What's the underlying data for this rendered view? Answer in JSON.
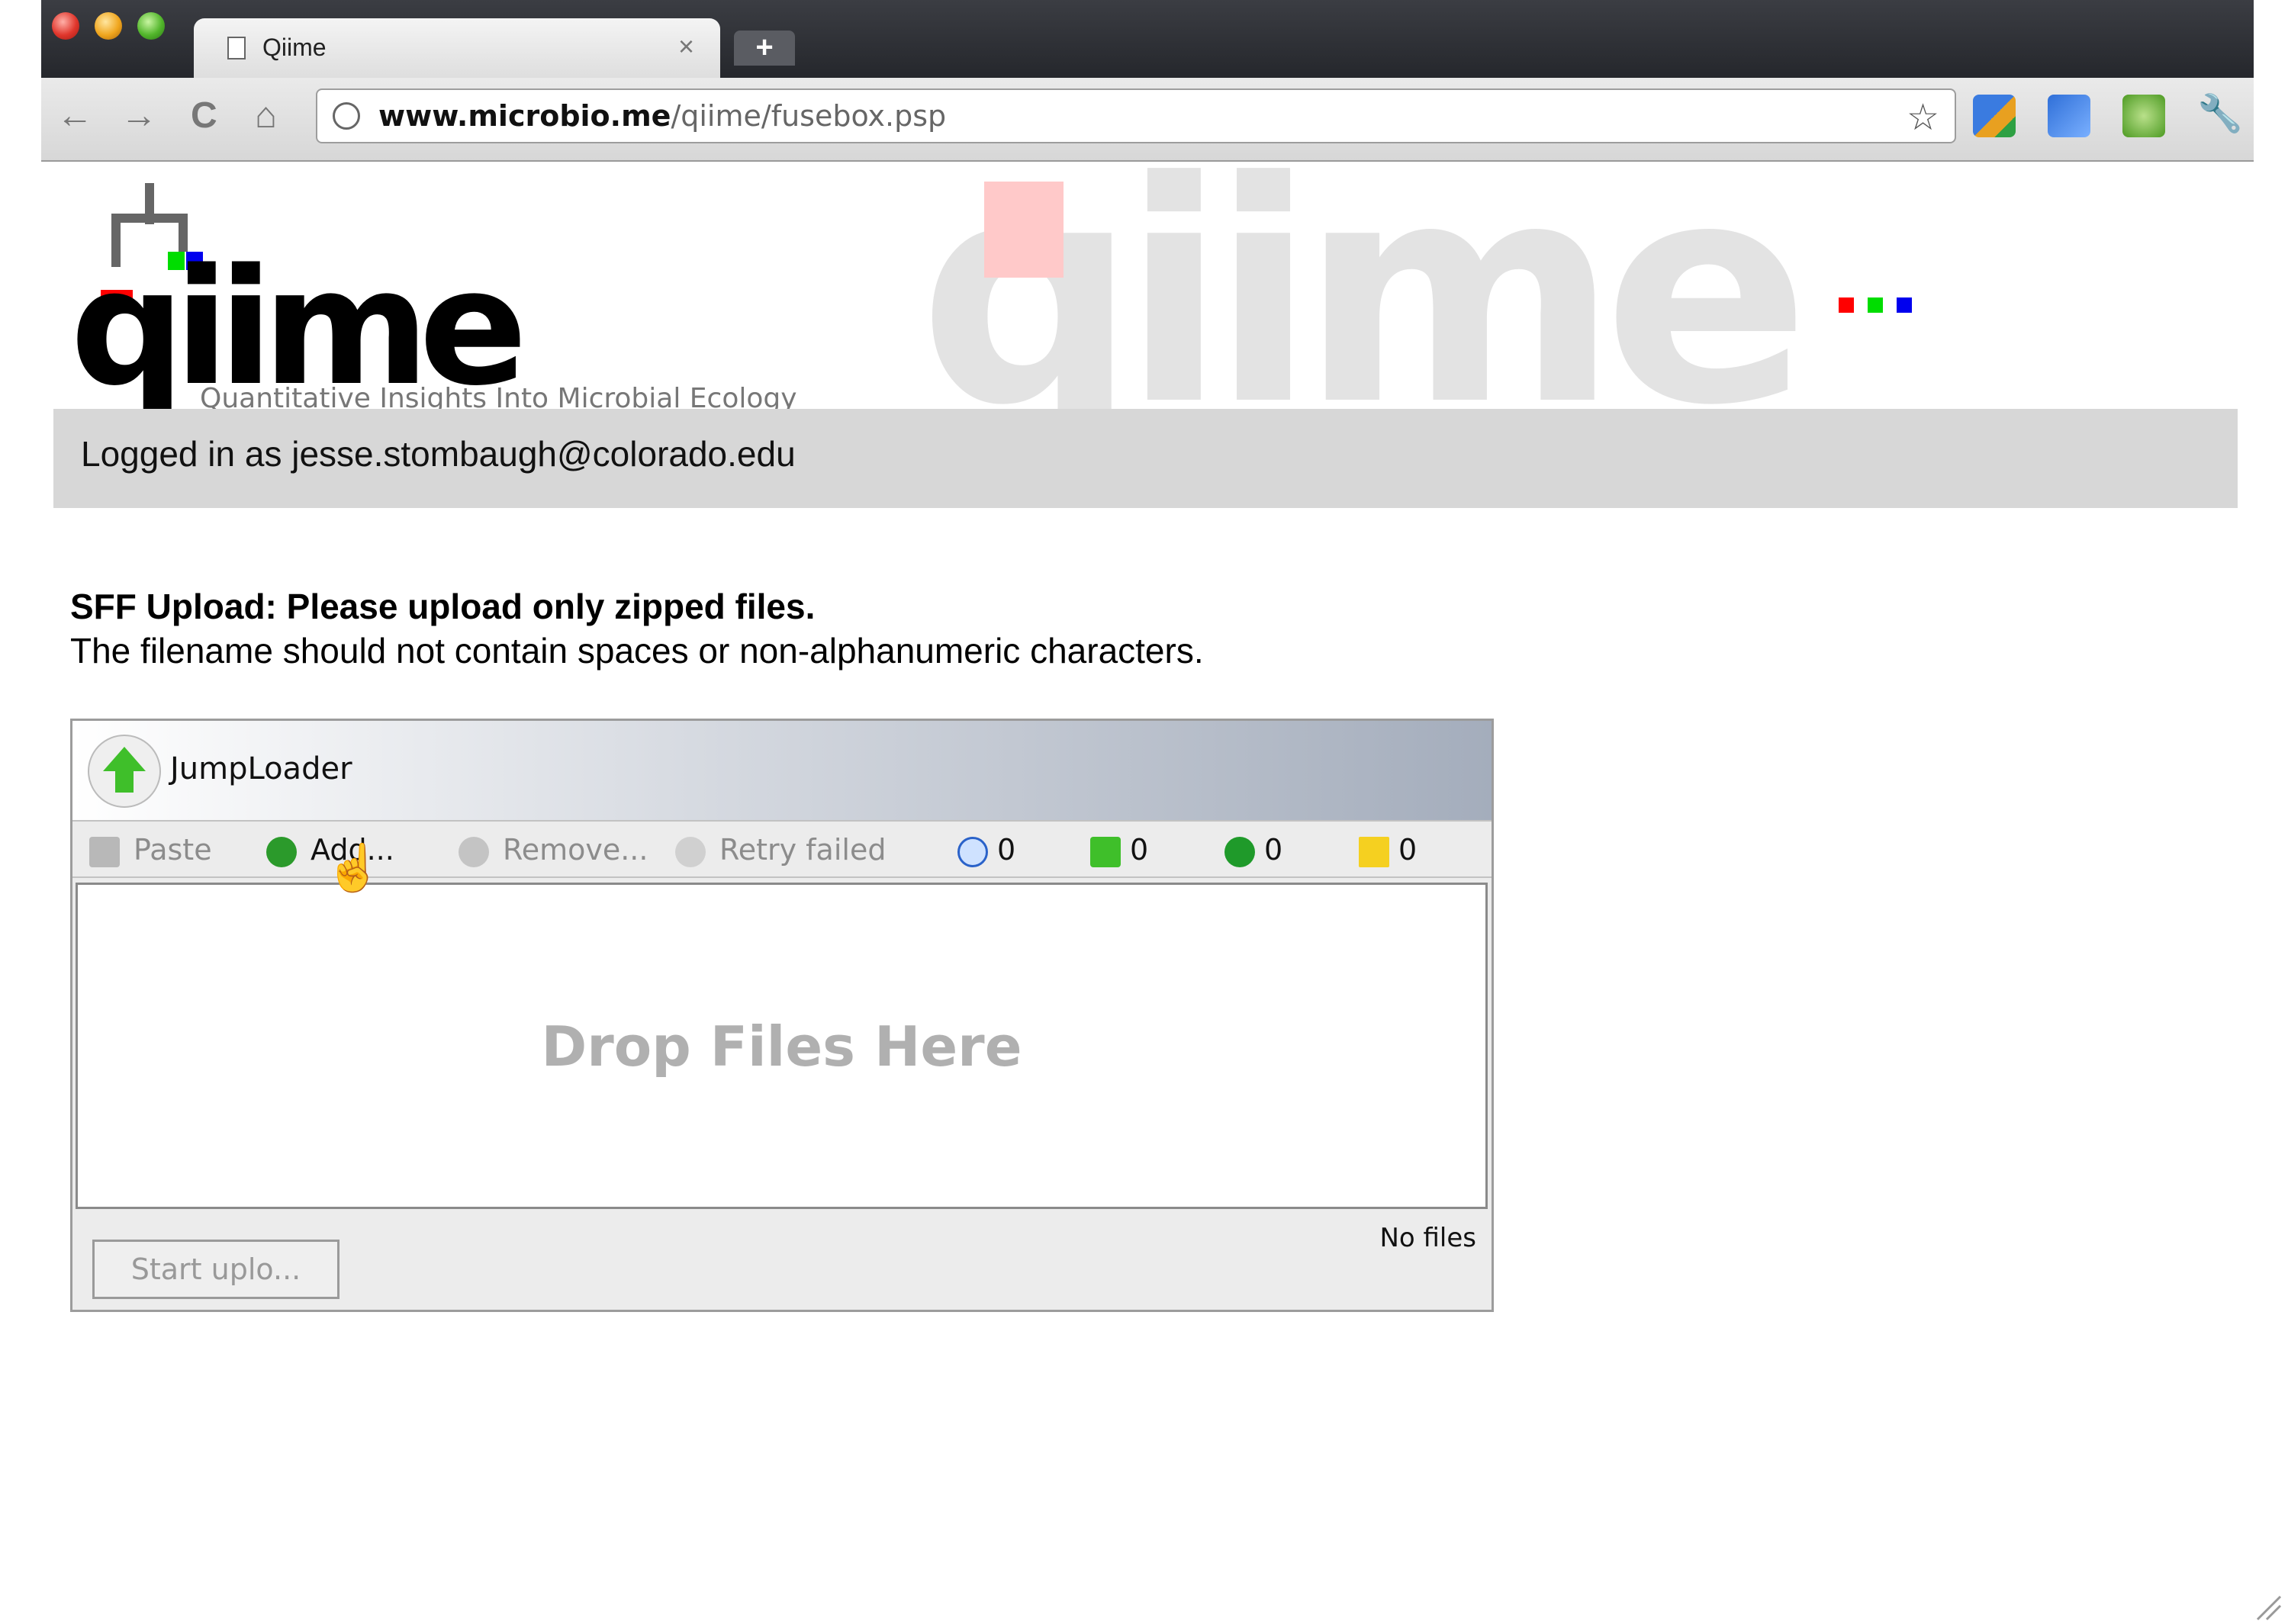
{
  "browser": {
    "tab_title": "Qiime",
    "tab_close": "×",
    "new_tab": "+",
    "url_host": "www.microbio.me",
    "url_path": "/qiime/fusebox.psp",
    "nav_back": "←",
    "nav_forward": "→",
    "nav_reload": "C",
    "nav_home": "⌂",
    "star": "☆",
    "wrench": "🔧"
  },
  "header": {
    "logo_text": "qiime",
    "tagline": "Quantitative Insights Into Microbial Ecology",
    "watermark": "qiime"
  },
  "login": {
    "text": "Logged in as jesse.stombaugh@colorado.edu"
  },
  "upload": {
    "heading": "SFF Upload: Please upload only zipped files.",
    "note": "The filename should not contain spaces or non-alphanumeric characters."
  },
  "jumploader": {
    "title": "JumpLoader",
    "toolbar": {
      "paste": "Paste",
      "add": "Add...",
      "remove": "Remove...",
      "retry": "Retry failed",
      "pending_count": "0",
      "uploading_count": "0",
      "done_count": "0",
      "failed_count": "0"
    },
    "drop_text": "Drop Files Here",
    "status": "No files",
    "start_button": "Start uplo..."
  },
  "colors": {
    "accent_red": "#ff0000",
    "accent_green": "#00dd00",
    "accent_blue": "#0000ee"
  }
}
